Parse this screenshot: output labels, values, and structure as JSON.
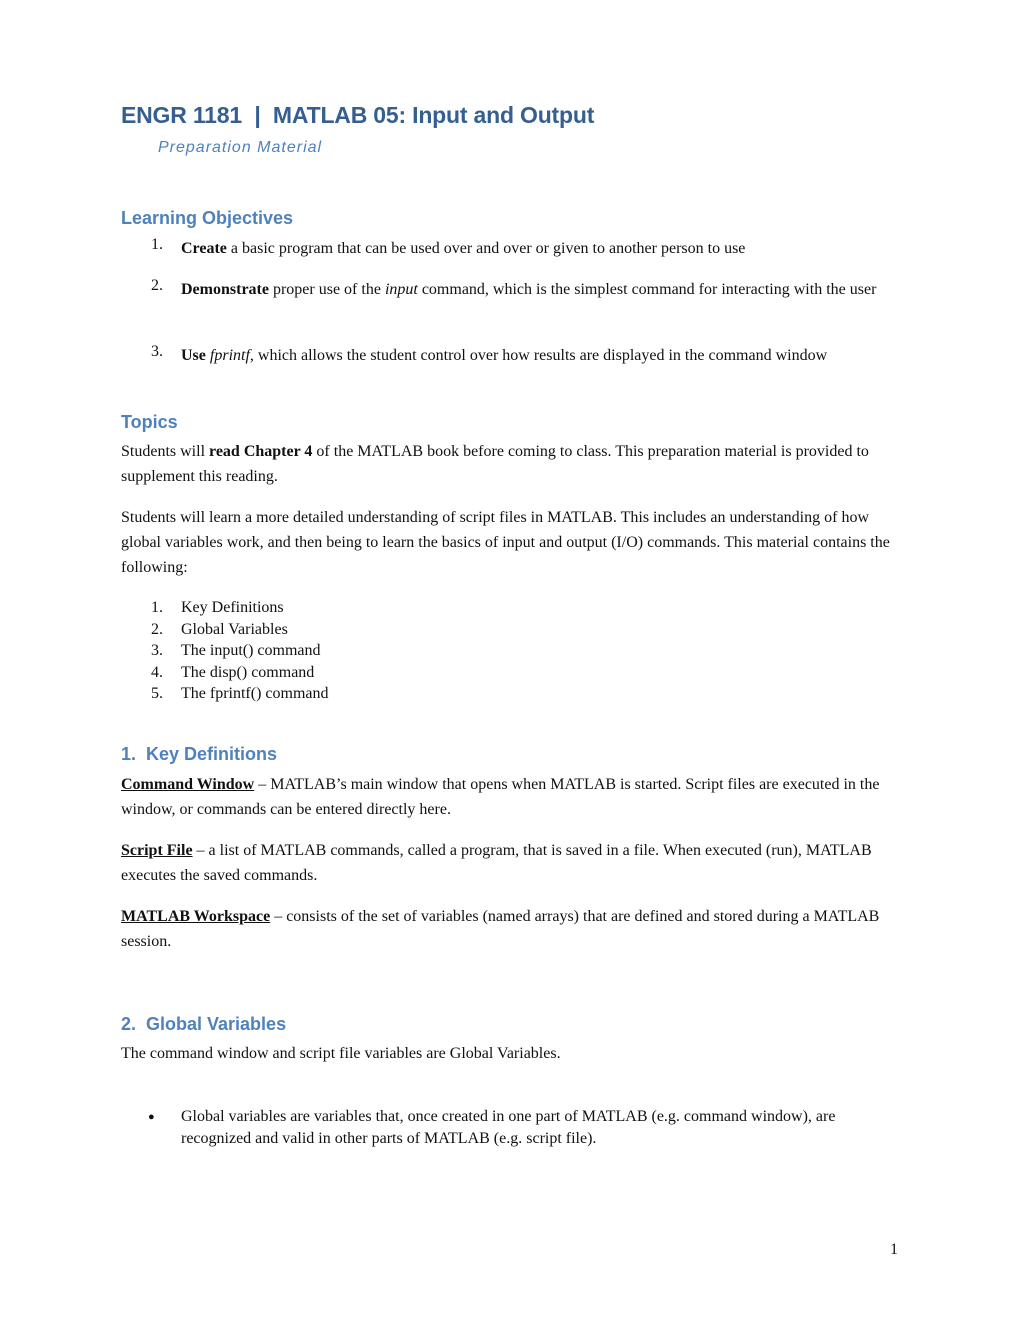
{
  "header": {
    "title": "ENGR 1181  |  MATLAB 05: Input and Output",
    "subtitle": "Preparation Material"
  },
  "learning_objectives": {
    "heading": "Learning Objectives",
    "items": [
      {
        "num": "1.",
        "bold": "Create",
        "text": " a basic program that can be used over and over or given to another person to use"
      },
      {
        "num": "2.",
        "bold": "Demonstrate",
        "pre": " proper use of the ",
        "italic": "input",
        "post": " command, which is the simplest command for interacting with the user"
      },
      {
        "num": "3.",
        "bold": "Use",
        "pre": " ",
        "italic": "fprintf,",
        "post": " which allows the student control over how results are displayed in the command window"
      }
    ]
  },
  "topics": {
    "heading": "Topics",
    "para1": {
      "pre": "Students will ",
      "bold": "read Chapter 4",
      "post": " of the MATLAB book before coming to class.  This preparation material is provided to supplement this reading."
    },
    "para2": "Students will learn a more detailed understanding of script files in MATLAB.  This includes an understanding of how global variables work, and then being to learn the basics of input and output (I/O) commands.  This material contains the following:",
    "list": [
      {
        "num": "1.",
        "text": "Key Definitions"
      },
      {
        "num": "2.",
        "text": "Global Variables"
      },
      {
        "num": "3.",
        "text": "The input() command"
      },
      {
        "num": "4.",
        "text": "The disp() command"
      },
      {
        "num": "5.",
        "text": "The fprintf() command"
      }
    ]
  },
  "key_definitions": {
    "heading": "1.  Key Definitions",
    "items": [
      {
        "term": "Command Window",
        "definition": " – MATLAB’s main window that opens when MATLAB is started.  Script files are executed in the window, or commands can be entered directly here."
      },
      {
        "term": "Script File",
        "definition": " – a list of MATLAB commands, called a program, that is saved in a file.  When executed (run), MATLAB executes the saved commands."
      },
      {
        "term": "MATLAB Workspace",
        "definition": " – consists of the set of variables (named arrays) that are defined and stored during a MATLAB session."
      }
    ]
  },
  "global_variables": {
    "heading": "2.  Global Variables",
    "intro": "The command window and script file variables are Global Variables.",
    "bullets": [
      {
        "icon": "bullet-icon",
        "glyph": "●",
        "text": "Global variables are variables that, once created in one part of MATLAB (e.g. command window), are recognized and valid in other parts of MATLAB (e.g. script file)."
      }
    ]
  },
  "footer": {
    "page_number": "1"
  },
  "colors": {
    "title": "#365f91",
    "heading": "#4f81bd",
    "text": "#111111"
  }
}
